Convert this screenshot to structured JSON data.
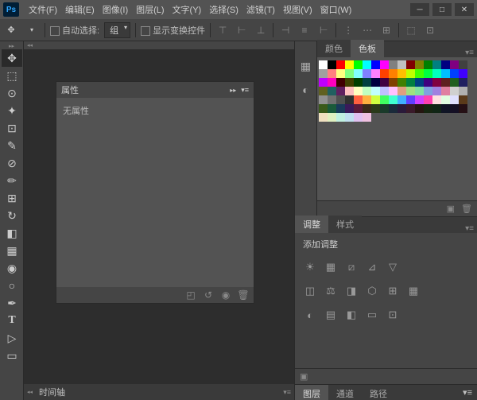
{
  "app": {
    "logo": "Ps"
  },
  "menubar": [
    "文件(F)",
    "编辑(E)",
    "图像(I)",
    "图层(L)",
    "文字(Y)",
    "选择(S)",
    "滤镜(T)",
    "视图(V)",
    "窗口(W)"
  ],
  "options": {
    "auto_select_label": "自动选择:",
    "group": "组",
    "show_transform_label": "显示变换控件"
  },
  "panels": {
    "properties": {
      "title": "属性",
      "body": "无属性"
    },
    "color": {
      "tab1": "颜色",
      "tab2": "色板"
    },
    "adjustments": {
      "tab1": "调整",
      "tab2": "样式",
      "add_label": "添加调整"
    },
    "layers": {
      "tab1": "图层",
      "tab2": "通道",
      "tab3": "路径"
    },
    "timeline": {
      "label": "时间轴"
    }
  },
  "swatch_colors": [
    "#ffffff",
    "#000000",
    "#ff0000",
    "#ffff00",
    "#00ff00",
    "#00ffff",
    "#0000ff",
    "#ff00ff",
    "#808080",
    "#c0c0c0",
    "#800000",
    "#808000",
    "#008000",
    "#008080",
    "#000080",
    "#800080",
    "#404040",
    "#a0a0a0",
    "#ff8080",
    "#ffff80",
    "#80ff80",
    "#80ffff",
    "#8080ff",
    "#ff80ff",
    "#ff4000",
    "#ff8000",
    "#ffbf00",
    "#bfff00",
    "#40ff00",
    "#00ff40",
    "#00ffbf",
    "#00bfff",
    "#0040ff",
    "#4000ff",
    "#bf00ff",
    "#ff00bf",
    "#400000",
    "#404000",
    "#004000",
    "#004040",
    "#000040",
    "#400040",
    "#804000",
    "#408000",
    "#008040",
    "#004080",
    "#400080",
    "#800040",
    "#602020",
    "#206020",
    "#202060",
    "#606020",
    "#206060",
    "#602060",
    "#ffc0c0",
    "#ffffc0",
    "#c0ffc0",
    "#c0ffff",
    "#c0c0ff",
    "#ffc0ff",
    "#e0a080",
    "#a0e080",
    "#80e0a0",
    "#80a0e0",
    "#a080e0",
    "#e080a0",
    "#d0d0d0",
    "#b0b0b0",
    "#909090",
    "#707070",
    "#505050",
    "#303030",
    "#ff6040",
    "#ffb040",
    "#d0ff40",
    "#40ff60",
    "#40ffd0",
    "#40b0ff",
    "#6040ff",
    "#d040ff",
    "#ff40b0",
    "#ffe0e0",
    "#e0ffe0",
    "#e0e0ff",
    "#5a3a1a",
    "#3a5a1a",
    "#1a5a3a",
    "#1a3a5a",
    "#3a1a5a",
    "#5a1a3a",
    "#3a2a1a",
    "#2a3a1a",
    "#1a3a2a",
    "#1a2a3a",
    "#2a1a3a",
    "#3a1a2a",
    "#251510",
    "#152510",
    "#102515",
    "#101525",
    "#151025",
    "#251015",
    "#f0e0c0",
    "#e0f0c0",
    "#c0f0e0",
    "#c0e0f0",
    "#e0c0f0",
    "#f0c0e0"
  ]
}
